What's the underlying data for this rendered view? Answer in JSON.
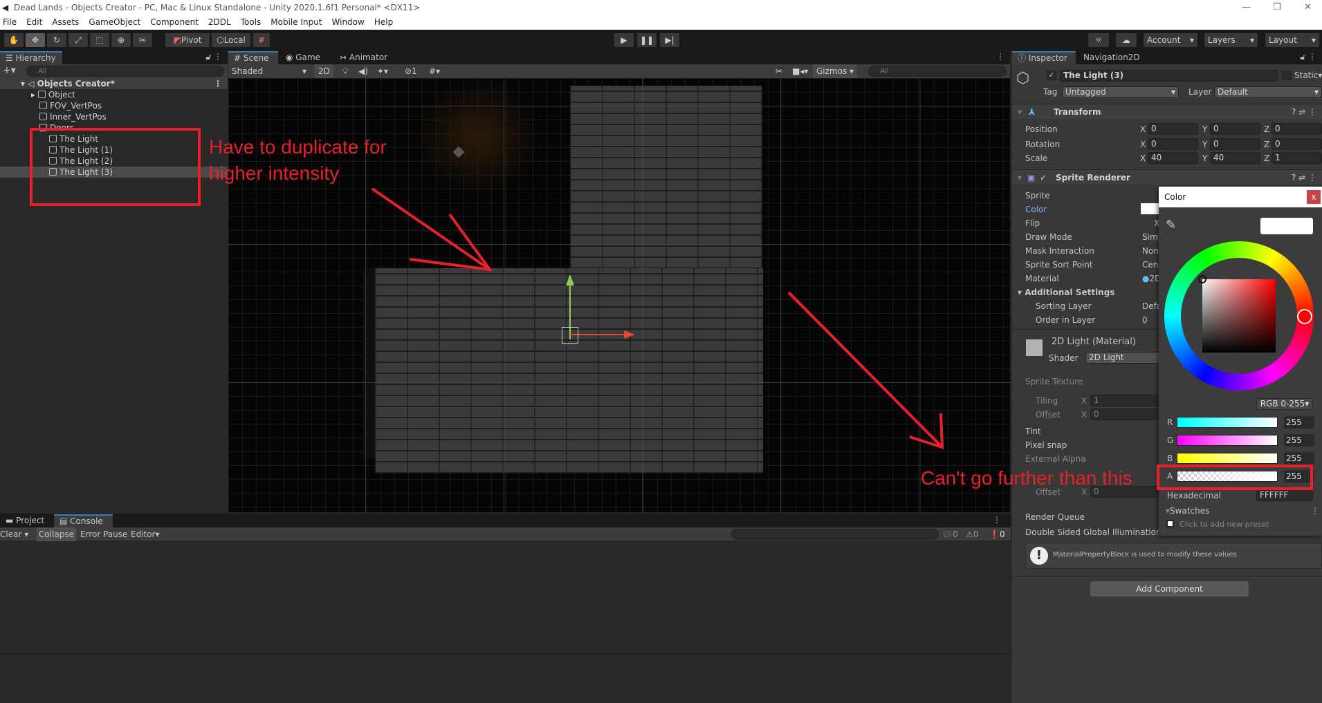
{
  "window": {
    "title": "Dead Lands - Objects Creator - PC, Mac & Linux Standalone - Unity 2020.1.6f1 Personal* <DX11>"
  },
  "menu": [
    "File",
    "Edit",
    "Assets",
    "GameObject",
    "Component",
    "2DDL",
    "Tools",
    "Mobile Input",
    "Window",
    "Help"
  ],
  "toolbar": {
    "pivot": "Pivot",
    "local": "Local",
    "account": "Account",
    "layers": "Layers",
    "layout": "Layout"
  },
  "hierarchy": {
    "tab": "Hierarchy",
    "search_placeholder": "All",
    "scene": "Objects Creator*",
    "items": [
      {
        "label": "Object",
        "depth": 1,
        "expandable": true
      },
      {
        "label": "FOV_VertPos",
        "depth": 1
      },
      {
        "label": "Inner_VertPos",
        "depth": 1
      },
      {
        "label": "Doors",
        "depth": 1,
        "expanded": true
      },
      {
        "label": "The Light",
        "depth": 2
      },
      {
        "label": "The Light (1)",
        "depth": 2
      },
      {
        "label": "The Light (2)",
        "depth": 2
      },
      {
        "label": "The Light (3)",
        "depth": 2,
        "selected": true
      }
    ]
  },
  "scene": {
    "tabs": [
      "Scene",
      "Game",
      "Animator"
    ],
    "shading": "Shaded",
    "mode_2d": "2D",
    "fx_count": "1",
    "gizmos": "Gizmos",
    "search_placeholder": "All"
  },
  "annotations": {
    "top": "Have to duplicate for higher intensity",
    "bottom": "Can't go further than this",
    "color": "#e8202a"
  },
  "inspector": {
    "tabs": [
      "Inspector",
      "Navigation2D"
    ],
    "object_name": "The Light (3)",
    "static_label": "Static",
    "tag_label": "Tag",
    "tag": "Untagged",
    "layer_label": "Layer",
    "layer": "Default",
    "transform": {
      "title": "Transform",
      "rows": [
        {
          "label": "Position",
          "x": "0",
          "y": "0",
          "z": "0"
        },
        {
          "label": "Rotation",
          "x": "0",
          "y": "0",
          "z": "0"
        },
        {
          "label": "Scale",
          "x": "40",
          "y": "40",
          "z": "1"
        }
      ]
    },
    "sprite_renderer": {
      "title": "Sprite Renderer",
      "rows": [
        {
          "label": "Sprite",
          "value": ""
        },
        {
          "label": "Color",
          "value": ""
        },
        {
          "label": "Flip",
          "value": "X"
        },
        {
          "label": "Draw Mode",
          "value": "Simp"
        },
        {
          "label": "Mask Interaction",
          "value": "Non"
        },
        {
          "label": "Sprite Sort Point",
          "value": "Cen"
        },
        {
          "label": "Material",
          "value": "2D"
        }
      ],
      "additional": "Additional Settings",
      "sorting_layer": "Sorting Layer",
      "sorting_layer_value": "Defa",
      "order": "Order in Layer",
      "order_value": "0"
    },
    "material": {
      "title": "2D Light (Material)",
      "shader_label": "Shader",
      "shader": "2D Light",
      "sprite_texture": "Sprite Texture",
      "tiling": "Tiling",
      "tiling_x": "1",
      "offset": "Offset",
      "offset_x": "0",
      "tint": "Tint",
      "pixel_snap": "Pixel snap",
      "external_alpha": "External Alpha",
      "offset2": "Offset",
      "offset2_x": "0",
      "render_queue": "Render Queue",
      "dsgi": "Double Sided Global Illumination",
      "info": "MaterialPropertyBlock is used to modify these values"
    },
    "add_component": "Add Component"
  },
  "color_picker": {
    "title": "Color",
    "close": "x",
    "mode": "RGB 0-255",
    "channels": [
      {
        "label": "R",
        "value": "255"
      },
      {
        "label": "G",
        "value": "255"
      },
      {
        "label": "B",
        "value": "255"
      },
      {
        "label": "A",
        "value": "255"
      }
    ],
    "hex_label": "Hexadecimal",
    "hex": "FFFFFF",
    "swatches": "Swatches",
    "preset_hint": "Click to add new preset",
    "hue_color": "#ff0000",
    "current_color": "#ffffff"
  },
  "console": {
    "tabs": [
      "Project",
      "Console"
    ],
    "buttons": [
      "Clear",
      "Collapse",
      "Error Pause",
      "Editor"
    ],
    "counts": {
      "info": "0",
      "warn": "0",
      "error": "0"
    }
  }
}
